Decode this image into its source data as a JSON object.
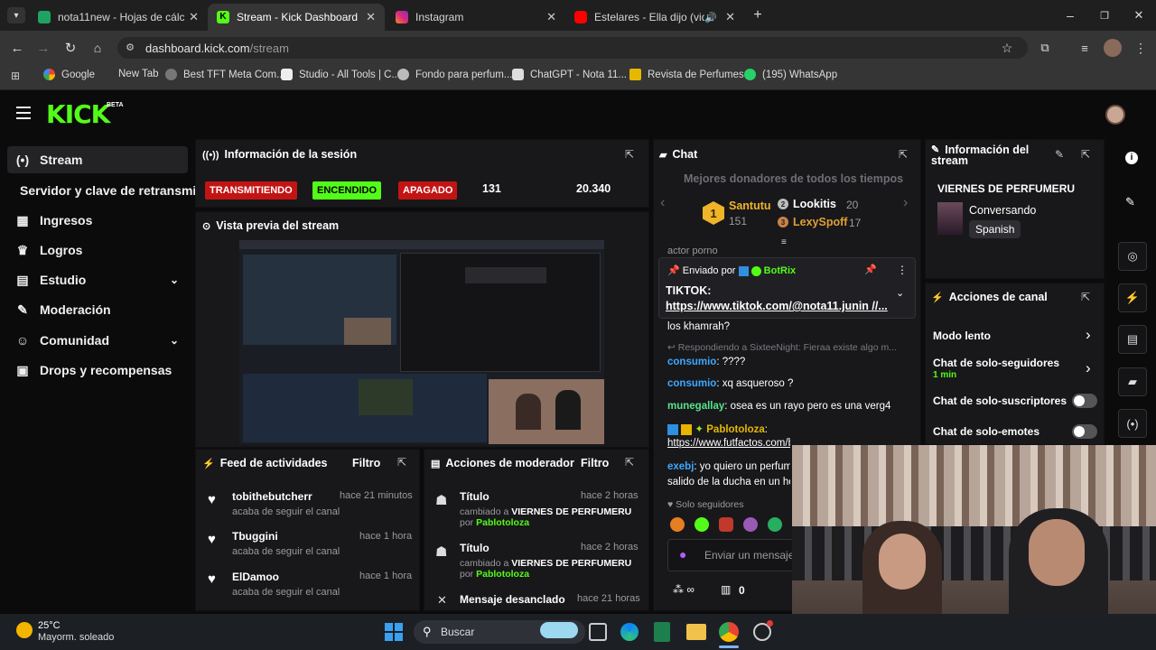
{
  "browser": {
    "tabs": [
      {
        "title": "nota11new - Hojas de cálculo d",
        "color": "#1ea362"
      },
      {
        "title": "Stream - Kick Dashboard",
        "color": "#53fc18"
      },
      {
        "title": "Instagram",
        "color": "#d62976"
      },
      {
        "title": "Estelares - Ella dijo (video o",
        "color": "#ff0000"
      }
    ],
    "url_domain": "dashboard.kick.com",
    "url_path": "/stream",
    "bookmarks": [
      "Google",
      "New Tab",
      "Best TFT Meta Com...",
      "Studio - All Tools | C...",
      "Fondo para perfum...",
      "ChatGPT - Nota 11...",
      "Revista de Perfumes...",
      "(195) WhatsApp"
    ]
  },
  "kick": {
    "logo": "KICK",
    "logo_tag": "BETA",
    "sidebar": [
      {
        "label": "Stream",
        "icon": "broadcast-icon"
      },
      {
        "label": "Servidor y clave de retransmisión",
        "icon": ""
      },
      {
        "label": "Ingresos",
        "icon": "bank-icon"
      },
      {
        "label": "Logros",
        "icon": "trophy-icon"
      },
      {
        "label": "Estudio",
        "icon": "studio-icon"
      },
      {
        "label": "Moderación",
        "icon": "wrench-icon"
      },
      {
        "label": "Comunidad",
        "icon": "users-icon"
      },
      {
        "label": "Drops y recompensas",
        "icon": "gift-icon"
      }
    ],
    "session": {
      "title": "Información de la sesión",
      "status_live": "TRANSMITIENDO",
      "status_on": "ENCENDIDO",
      "status_off": "APAGADO",
      "viewers": "131",
      "followers": "20.340"
    },
    "preview": {
      "title": "Vista previa del stream"
    },
    "activity": {
      "title": "Feed de actividades",
      "filter": "Filtro",
      "items": [
        {
          "user": "tobithebutcherr",
          "time": "hace 21 minutos",
          "action": "acaba de seguir el canal"
        },
        {
          "user": "Tbuggini",
          "time": "hace 1 hora",
          "action": "acaba de seguir el canal"
        },
        {
          "user": "ElDamoo",
          "time": "hace 1 hora",
          "action": "acaba de seguir el canal"
        }
      ]
    },
    "modactions": {
      "title": "Acciones de moderador",
      "filter": "Filtro",
      "items": [
        {
          "label": "Título",
          "time": "hace 2 horas",
          "changed": "cambiado a",
          "value": "VIERNES DE PERFUMERU",
          "by": "por",
          "user": "Pablotoloza"
        },
        {
          "label": "Título",
          "time": "hace 2 horas",
          "changed": "cambiado a",
          "value": "VIERNES DE PERFUMERU",
          "by": "por",
          "user": "Pablotoloza"
        }
      ],
      "last_label": "Mensaje desanclado",
      "last_time": "hace 21 horas"
    },
    "chat": {
      "title": "Chat",
      "top_title": "Mejores donadores de todos los tiempos",
      "donors": [
        {
          "rank": "1",
          "name": "Santutu",
          "amount": "151"
        },
        {
          "rank": "2",
          "name": "Lookitis",
          "amount": "20"
        },
        {
          "rank": "3",
          "name": "LexySpoff",
          "amount": "17"
        }
      ],
      "cut_msg": "actor porno",
      "pinned_by": "Enviado por",
      "pinned_user": "BotRix",
      "pinned_l1": "TIKTOK:",
      "pinned_l2": "https://www.tiktok.com/@nota11.junin //...",
      "m_khamrah": "los khamrah?",
      "reply_text": "Respondiendo a SixteeNight: Fieraa existe algo m...",
      "messages": [
        {
          "user": "consumio",
          "text": ": ????"
        },
        {
          "user": "consumio",
          "text": ": xq asqueroso ?"
        },
        {
          "user": "munegallay",
          "text": ": osea es un rayo pero es una verg4"
        }
      ],
      "pablo_user": "Pablotoloza",
      "pablo_link": "https://www.futfactos.com/bocajuniors",
      "exebj_user": "exebj",
      "exebj_text": ": yo quiero un perfume que tenga olor a jabón",
      "exebj_text2": "salido de la ducha en un hotel 5 estrellas",
      "followers_only": "Solo seguidores",
      "input_placeholder": "Enviar un mensaje",
      "points": "0"
    },
    "stream_info": {
      "title_line1": "Información del",
      "title_line2": "stream",
      "stream_title": "VIERNES DE PERFUMERU",
      "category": "Conversando",
      "language": "Spanish"
    },
    "channel_actions": {
      "title": "Acciones de canal",
      "items": [
        "Modo lento",
        "Chat de solo-seguidores",
        "Chat de solo-suscriptores",
        "Chat de solo-emotes"
      ],
      "followers_sub": "1 min"
    }
  },
  "taskbar": {
    "temp": "25°C",
    "weather": "Mayorm. soleado",
    "search": "Buscar"
  }
}
